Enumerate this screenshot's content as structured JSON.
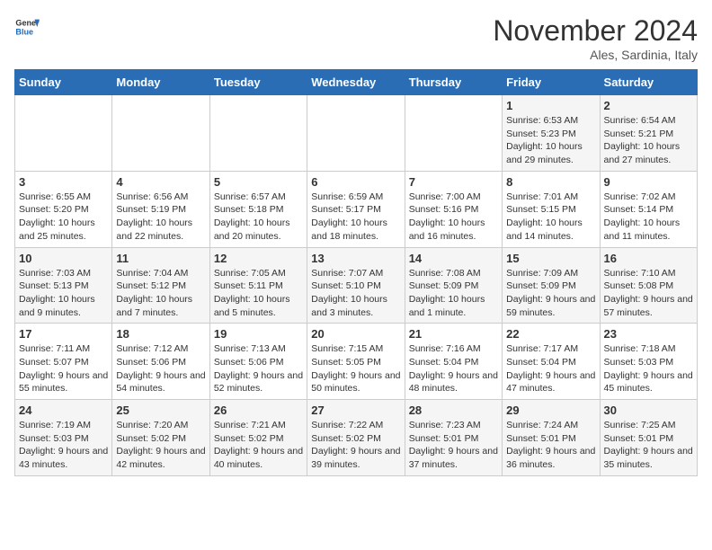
{
  "logo": {
    "text_general": "General",
    "text_blue": "Blue"
  },
  "header": {
    "month_year": "November 2024",
    "location": "Ales, Sardinia, Italy"
  },
  "days_of_week": [
    "Sunday",
    "Monday",
    "Tuesday",
    "Wednesday",
    "Thursday",
    "Friday",
    "Saturday"
  ],
  "weeks": [
    [
      {
        "day": "",
        "info": ""
      },
      {
        "day": "",
        "info": ""
      },
      {
        "day": "",
        "info": ""
      },
      {
        "day": "",
        "info": ""
      },
      {
        "day": "",
        "info": ""
      },
      {
        "day": "1",
        "info": "Sunrise: 6:53 AM\nSunset: 5:23 PM\nDaylight: 10 hours and 29 minutes."
      },
      {
        "day": "2",
        "info": "Sunrise: 6:54 AM\nSunset: 5:21 PM\nDaylight: 10 hours and 27 minutes."
      }
    ],
    [
      {
        "day": "3",
        "info": "Sunrise: 6:55 AM\nSunset: 5:20 PM\nDaylight: 10 hours and 25 minutes."
      },
      {
        "day": "4",
        "info": "Sunrise: 6:56 AM\nSunset: 5:19 PM\nDaylight: 10 hours and 22 minutes."
      },
      {
        "day": "5",
        "info": "Sunrise: 6:57 AM\nSunset: 5:18 PM\nDaylight: 10 hours and 20 minutes."
      },
      {
        "day": "6",
        "info": "Sunrise: 6:59 AM\nSunset: 5:17 PM\nDaylight: 10 hours and 18 minutes."
      },
      {
        "day": "7",
        "info": "Sunrise: 7:00 AM\nSunset: 5:16 PM\nDaylight: 10 hours and 16 minutes."
      },
      {
        "day": "8",
        "info": "Sunrise: 7:01 AM\nSunset: 5:15 PM\nDaylight: 10 hours and 14 minutes."
      },
      {
        "day": "9",
        "info": "Sunrise: 7:02 AM\nSunset: 5:14 PM\nDaylight: 10 hours and 11 minutes."
      }
    ],
    [
      {
        "day": "10",
        "info": "Sunrise: 7:03 AM\nSunset: 5:13 PM\nDaylight: 10 hours and 9 minutes."
      },
      {
        "day": "11",
        "info": "Sunrise: 7:04 AM\nSunset: 5:12 PM\nDaylight: 10 hours and 7 minutes."
      },
      {
        "day": "12",
        "info": "Sunrise: 7:05 AM\nSunset: 5:11 PM\nDaylight: 10 hours and 5 minutes."
      },
      {
        "day": "13",
        "info": "Sunrise: 7:07 AM\nSunset: 5:10 PM\nDaylight: 10 hours and 3 minutes."
      },
      {
        "day": "14",
        "info": "Sunrise: 7:08 AM\nSunset: 5:09 PM\nDaylight: 10 hours and 1 minute."
      },
      {
        "day": "15",
        "info": "Sunrise: 7:09 AM\nSunset: 5:09 PM\nDaylight: 9 hours and 59 minutes."
      },
      {
        "day": "16",
        "info": "Sunrise: 7:10 AM\nSunset: 5:08 PM\nDaylight: 9 hours and 57 minutes."
      }
    ],
    [
      {
        "day": "17",
        "info": "Sunrise: 7:11 AM\nSunset: 5:07 PM\nDaylight: 9 hours and 55 minutes."
      },
      {
        "day": "18",
        "info": "Sunrise: 7:12 AM\nSunset: 5:06 PM\nDaylight: 9 hours and 54 minutes."
      },
      {
        "day": "19",
        "info": "Sunrise: 7:13 AM\nSunset: 5:06 PM\nDaylight: 9 hours and 52 minutes."
      },
      {
        "day": "20",
        "info": "Sunrise: 7:15 AM\nSunset: 5:05 PM\nDaylight: 9 hours and 50 minutes."
      },
      {
        "day": "21",
        "info": "Sunrise: 7:16 AM\nSunset: 5:04 PM\nDaylight: 9 hours and 48 minutes."
      },
      {
        "day": "22",
        "info": "Sunrise: 7:17 AM\nSunset: 5:04 PM\nDaylight: 9 hours and 47 minutes."
      },
      {
        "day": "23",
        "info": "Sunrise: 7:18 AM\nSunset: 5:03 PM\nDaylight: 9 hours and 45 minutes."
      }
    ],
    [
      {
        "day": "24",
        "info": "Sunrise: 7:19 AM\nSunset: 5:03 PM\nDaylight: 9 hours and 43 minutes."
      },
      {
        "day": "25",
        "info": "Sunrise: 7:20 AM\nSunset: 5:02 PM\nDaylight: 9 hours and 42 minutes."
      },
      {
        "day": "26",
        "info": "Sunrise: 7:21 AM\nSunset: 5:02 PM\nDaylight: 9 hours and 40 minutes."
      },
      {
        "day": "27",
        "info": "Sunrise: 7:22 AM\nSunset: 5:02 PM\nDaylight: 9 hours and 39 minutes."
      },
      {
        "day": "28",
        "info": "Sunrise: 7:23 AM\nSunset: 5:01 PM\nDaylight: 9 hours and 37 minutes."
      },
      {
        "day": "29",
        "info": "Sunrise: 7:24 AM\nSunset: 5:01 PM\nDaylight: 9 hours and 36 minutes."
      },
      {
        "day": "30",
        "info": "Sunrise: 7:25 AM\nSunset: 5:01 PM\nDaylight: 9 hours and 35 minutes."
      }
    ]
  ]
}
